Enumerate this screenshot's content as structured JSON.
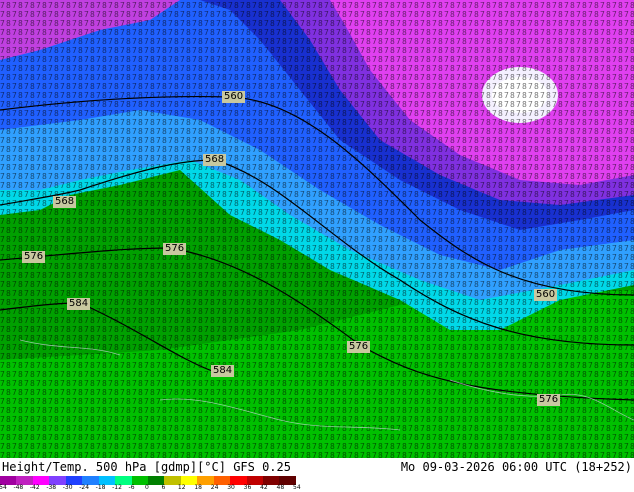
{
  "footer": {
    "title": "Height/Temp. 500 hPa [gdmp][°C] GFS 0.25",
    "timestamp": "Mo 09-03-2026 06:00 UTC (18+252)"
  },
  "contour_labels": [
    {
      "text": "560"
    },
    {
      "text": "568"
    },
    {
      "text": "568"
    },
    {
      "text": "576"
    },
    {
      "text": "576"
    },
    {
      "text": "584"
    },
    {
      "text": "576"
    },
    {
      "text": "584"
    },
    {
      "text": "560"
    },
    {
      "text": "576"
    }
  ],
  "legend": {
    "tick_labels": [
      "-54",
      "-48",
      "-42",
      "-38",
      "-30",
      "-24",
      "-18",
      "-12",
      "-6",
      "0",
      "6",
      "12",
      "18",
      "24",
      "30",
      "36",
      "42",
      "48",
      "54"
    ],
    "colors": [
      "#a000a0",
      "#c020c0",
      "#ff00ff",
      "#8040ff",
      "#2040ff",
      "#2080ff",
      "#00c0ff",
      "#00ff80",
      "#00c000",
      "#008000",
      "#c0c000",
      "#ffff00",
      "#ffa000",
      "#ff6000",
      "#ff0000",
      "#c00000",
      "#800000",
      "#600000"
    ]
  }
}
